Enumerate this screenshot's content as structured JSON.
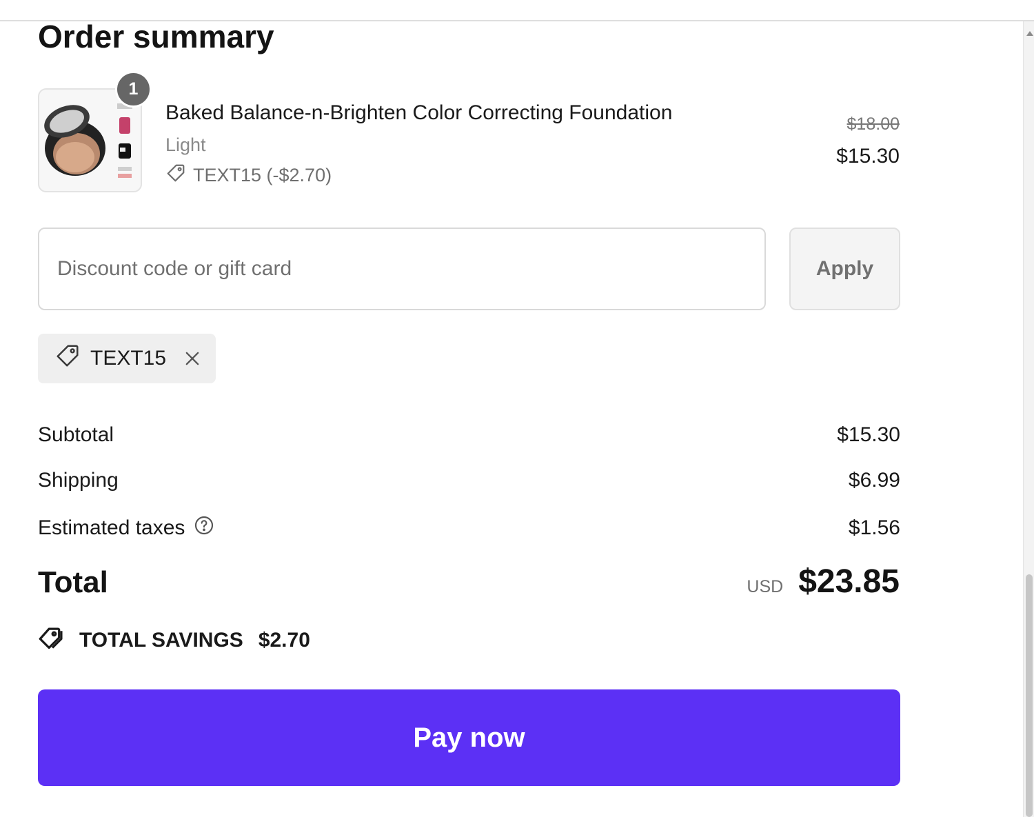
{
  "summary": {
    "title": "Order summary"
  },
  "line_item": {
    "quantity": "1",
    "name": "Baked Balance-n-Brighten Color Correcting Foundation",
    "variant": "Light",
    "discount_text": "TEXT15 (-$2.70)",
    "original_price": "$18.00",
    "price": "$15.30"
  },
  "discount": {
    "placeholder": "Discount code or gift card",
    "value": "",
    "apply_label": "Apply",
    "applied_code": "TEXT15"
  },
  "totals": {
    "subtotal_label": "Subtotal",
    "subtotal": "$15.30",
    "shipping_label": "Shipping",
    "shipping": "$6.99",
    "taxes_label": "Estimated taxes",
    "taxes": "$1.56",
    "total_label": "Total",
    "currency": "USD",
    "total": "$23.85",
    "savings_label": "TOTAL SAVINGS",
    "savings": "$2.70"
  },
  "actions": {
    "pay_label": "Pay now"
  },
  "colors": {
    "primary": "#5c30f5",
    "badge": "#666666"
  },
  "icons": [
    "tag-icon",
    "close-icon",
    "help-circle-icon",
    "tags-icon",
    "scroll-up-arrow-icon"
  ]
}
